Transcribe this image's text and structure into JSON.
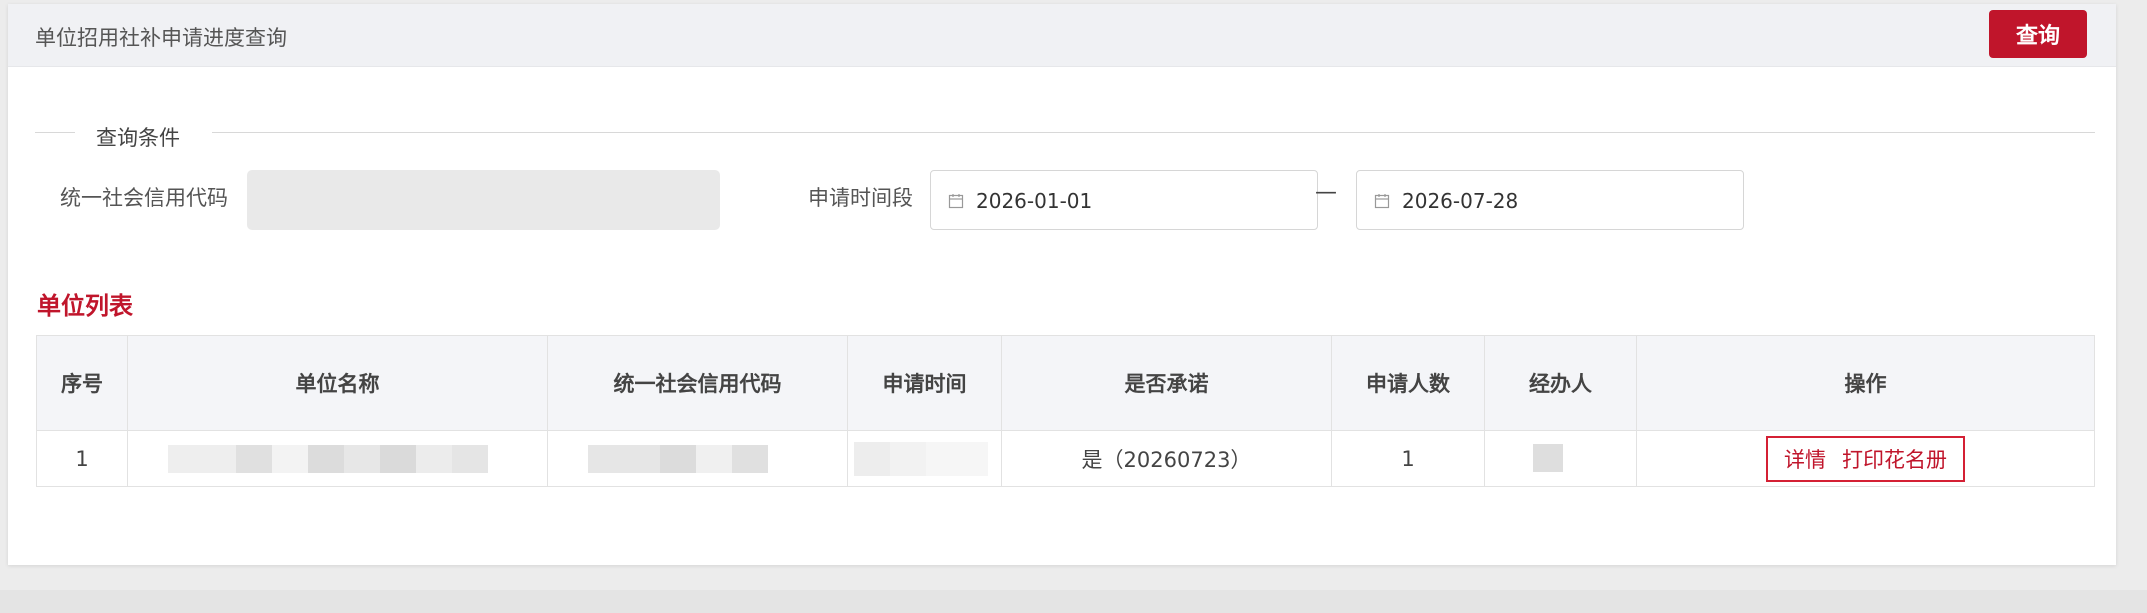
{
  "header": {
    "title": "单位招用社补申请进度查询",
    "query_button": "查询"
  },
  "query_section": {
    "legend": "查询条件",
    "credit_code_label": "统一社会信用代码",
    "credit_code_value": "",
    "date_range_label": "申请时间段",
    "start_date": "2026-01-01",
    "separator": "—",
    "end_date": "2026-07-28"
  },
  "list": {
    "title": "单位列表",
    "columns": [
      "序号",
      "单位名称",
      "统一社会信用代码",
      "申请时间",
      "是否承诺",
      "申请人数",
      "经办人",
      "操作"
    ],
    "rows": [
      {
        "index": "1",
        "unit_name": "",
        "credit_code": "",
        "apply_time": "",
        "promised": "是（20260723）",
        "applicant_count": "1",
        "handler": "",
        "actions": [
          "详情",
          "打印花名册"
        ]
      }
    ]
  },
  "colors": {
    "accent": "#c0152b",
    "header_bg": "#f0f1f4",
    "table_head_bg": "#f4f5f8"
  }
}
